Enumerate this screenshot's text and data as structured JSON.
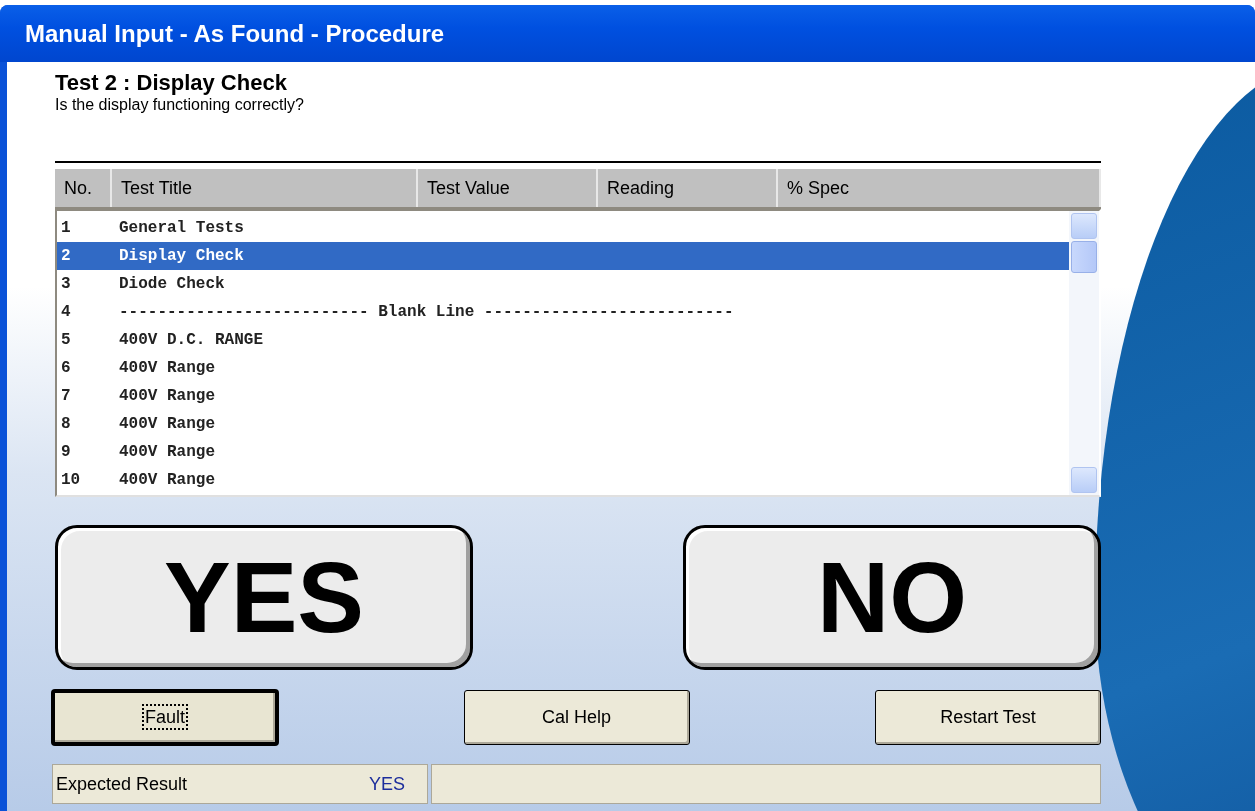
{
  "window": {
    "title": "Manual Input - As Found - Procedure"
  },
  "test": {
    "heading": "Test 2 : Display Check",
    "question": "Is the display functioning correctly?"
  },
  "table": {
    "columns": [
      "No.",
      "Test Title",
      "Test Value",
      "Reading",
      "% Spec"
    ],
    "rows": [
      {
        "no": "1",
        "title": "General Tests",
        "selected": false
      },
      {
        "no": "2",
        "title": "Display Check",
        "selected": true
      },
      {
        "no": "3",
        "title": "Diode Check",
        "selected": false
      },
      {
        "no": "4",
        "title": "-------------------------- Blank Line --------------------------",
        "selected": false
      },
      {
        "no": "5",
        "title": "400V D.C. RANGE",
        "selected": false
      },
      {
        "no": "6",
        "title": "400V Range",
        "selected": false
      },
      {
        "no": "7",
        "title": "400V Range",
        "selected": false
      },
      {
        "no": "8",
        "title": "400V Range",
        "selected": false
      },
      {
        "no": "9",
        "title": "400V Range",
        "selected": false
      },
      {
        "no": "10",
        "title": "400V Range",
        "selected": false
      }
    ]
  },
  "answers": [
    {
      "label": "YES"
    },
    {
      "label": "NO"
    }
  ],
  "buttons": [
    {
      "label": "Fault",
      "focused": true
    },
    {
      "label": "Cal Help",
      "focused": false
    },
    {
      "label": "Restart Test",
      "focused": false
    }
  ],
  "status_bar": {
    "label": "Expected Result",
    "value": "YES"
  }
}
